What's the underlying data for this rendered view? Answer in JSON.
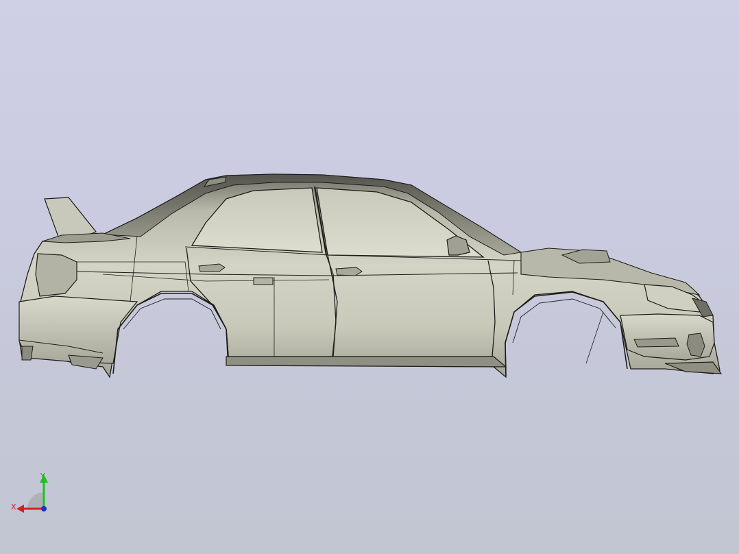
{
  "viewport": {
    "background_top": "#cfcfe6",
    "background_bottom": "#c2c6d2"
  },
  "model": {
    "body_color": "#c6c6b8",
    "edge_color": "#1c1c18"
  },
  "triad": {
    "x_label": "X",
    "y_label": "Y",
    "x_color": "#d02020",
    "y_color": "#20c020",
    "z_color": "#2030d0"
  }
}
